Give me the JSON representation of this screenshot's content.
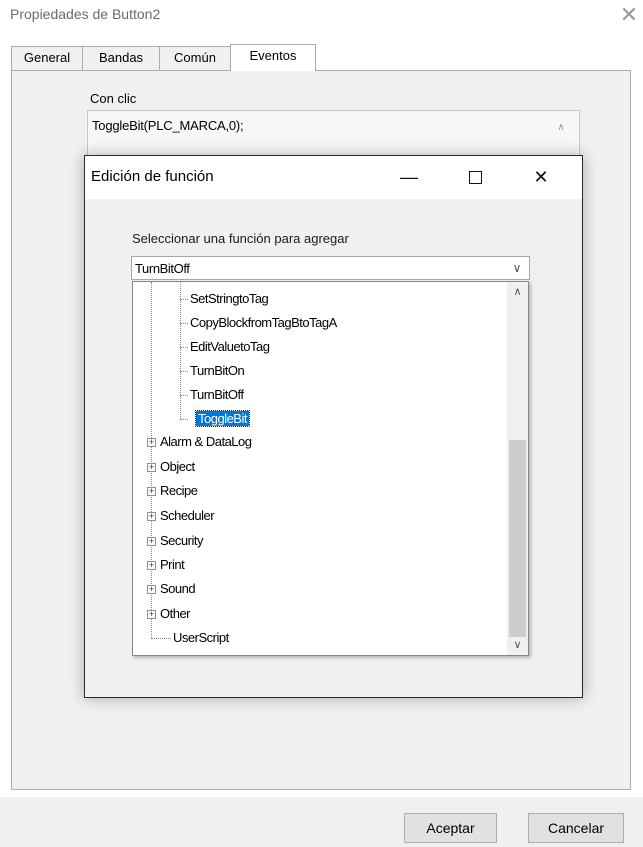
{
  "window": {
    "title": "Propiedades de Button2",
    "close_glyph": "✕"
  },
  "tabs": [
    {
      "label": "General"
    },
    {
      "label": "Bandas"
    },
    {
      "label": "Común"
    },
    {
      "label": "Eventos",
      "active": true
    }
  ],
  "events": {
    "onclick_label": "Con clic",
    "onclick_script": "ToggleBit(PLC_MARCA,0);"
  },
  "buttons": {
    "accept": "Aceptar",
    "cancel": "Cancelar"
  },
  "dialog": {
    "title": "Edición de función",
    "minimize_glyph": "—",
    "close_glyph": "✕",
    "select_label": "Seleccionar una función para agregar",
    "selected_function": "TurnBitOff",
    "combo_arrow": "∨",
    "tree": {
      "children": [
        "SetStringtoTag",
        "CopyBlockfromTagBtoTagA",
        "EditValuetoTag",
        "TurnBitOn",
        "TurnBitOff",
        "ToggleBit"
      ],
      "selected": "ToggleBit",
      "groups": [
        "Alarm & DataLog",
        "Object",
        "Recipe",
        "Scheduler",
        "Security",
        "Print",
        "Sound",
        "Other"
      ],
      "leaf": "UserScript",
      "expander_glyph": "+"
    },
    "scroll_up": "∧",
    "scroll_down": "∨"
  },
  "icons": {
    "close": "close-icon",
    "minimize": "minimize-icon",
    "maximize": "maximize-icon",
    "dropdown": "chevron-down-icon",
    "scroll_up": "chevron-up-icon",
    "scroll_down": "chevron-down-icon"
  },
  "colors": {
    "selection": "#0078d7",
    "window_background": "#f0f0f0"
  }
}
